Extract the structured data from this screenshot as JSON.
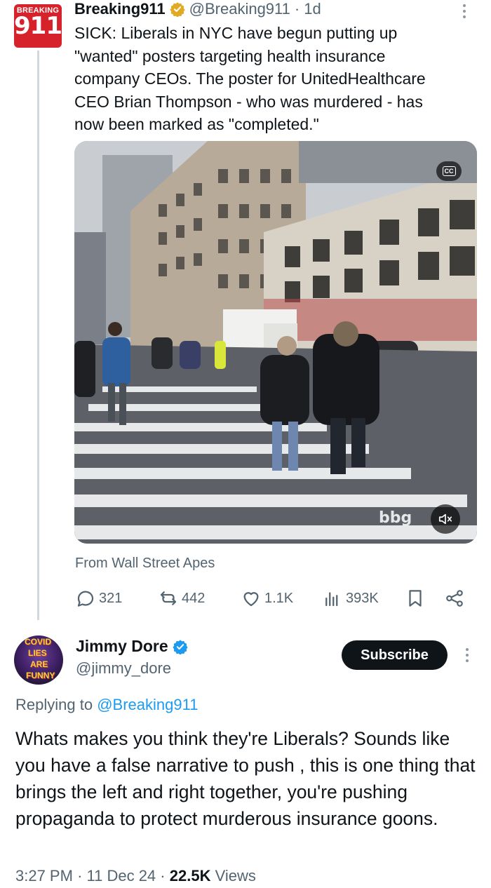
{
  "original_tweet": {
    "avatar_text_top": "BREAKING",
    "avatar_text_main": "911",
    "display_name": "Breaking911",
    "handle": "@Breaking911",
    "separator": "·",
    "age": "1d",
    "text": "SICK: Liberals in NYC have begun putting up\n\"wanted\" posters targeting health insurance\ncompany CEOs. The poster for UnitedHealthcare\nCEO Brian Thompson - who was murdered - has\nnow been marked as \"completed.\"",
    "media": {
      "cc_label": "CC",
      "watermark": "bbg",
      "mute_icon": "speaker-muted-icon"
    },
    "source_label": "From Wall Street Apes",
    "stats": {
      "replies": "321",
      "reposts": "442",
      "likes": "1.1K",
      "views": "393K"
    }
  },
  "reply_tweet": {
    "avatar_lines": [
      "COVID",
      "LIES",
      "ARE",
      "FUNNY"
    ],
    "display_name": "Jimmy Dore",
    "handle": "@jimmy_dore",
    "subscribe_label": "Subscribe",
    "replying_prefix": "Replying to",
    "replying_to": "@Breaking911",
    "text": "Whats makes you think they're Liberals? Sounds like you have a false narrative to push , this is one thing that brings the left and right together, you're pushing propaganda to protect murderous insurance goons.",
    "time": "3:27 PM",
    "date": "11 Dec 24",
    "views_count": "22.5K",
    "views_label": "Views"
  },
  "colors": {
    "text": "#0f1419",
    "muted": "#536471",
    "link": "#1d9bf0",
    "verified": "#e2a922",
    "verified_blue": "#1d9bf0",
    "brand_red": "#d6232b"
  }
}
